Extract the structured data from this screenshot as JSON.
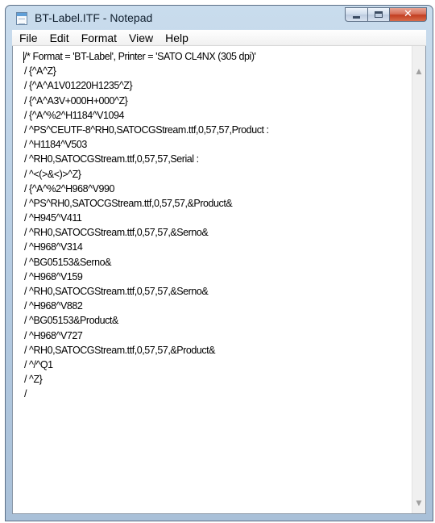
{
  "window": {
    "title": "BT-Label.ITF - Notepad",
    "close_glyph": "✕"
  },
  "menu": [
    "File",
    "Edit",
    "Format",
    "View",
    "Help"
  ],
  "scrollbar": {
    "up_glyph": "▲",
    "down_glyph": "▼"
  },
  "document": {
    "lines": [
      "/* Format = 'BT-Label', Printer = 'SATO CL4NX (305 dpi)'",
      "/ {^A^Z}",
      "/ {^A^A1V01220H1235^Z}",
      "/ {^A^A3V+000H+000^Z}",
      "/ {^A^%2^H1184^V1094",
      "/ ^PS^CEUTF-8^RH0,SATOCGStream.ttf,0,57,57,Product :",
      "/ ^H1184^V503",
      "/ ^RH0,SATOCGStream.ttf,0,57,57,Serial :",
      "/ ^<(>&<)>^Z}",
      "/ {^A^%2^H968^V990",
      "/ ^PS^RH0,SATOCGStream.ttf,0,57,57,&Product&",
      "/ ^H945^V411",
      "/ ^RH0,SATOCGStream.ttf,0,57,57,&Serno&",
      "/ ^H968^V314",
      "/ ^BG05153&Serno&",
      "/ ^H968^V159",
      "/ ^RH0,SATOCGStream.ttf,0,57,57,&Serno&",
      "/ ^H968^V882",
      "/ ^BG05153&Product&",
      "/ ^H968^V727",
      "/ ^RH0,SATOCGStream.ttf,0,57,57,&Product&",
      "/ ^/^Q1",
      "/ ^Z}",
      "/"
    ]
  }
}
